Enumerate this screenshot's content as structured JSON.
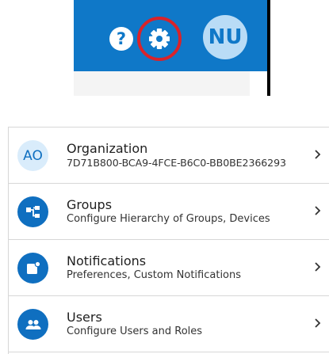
{
  "header": {
    "help_glyph": "?",
    "user_initials": "NU",
    "accent": "#0f78c8",
    "highlight_ring": "#d9232a",
    "icons": [
      "help-icon",
      "gear-icon"
    ]
  },
  "menu": {
    "items": [
      {
        "id": "organization",
        "initials": "AO",
        "title": "Organization",
        "subtitle": "7D71B800-BCA9-4FCE-B6C0-BB0BE2366293"
      },
      {
        "id": "groups",
        "icon": "hierarchy-icon",
        "title": "Groups",
        "subtitle": "Configure Hierarchy of Groups, Devices"
      },
      {
        "id": "notifications",
        "icon": "notification-icon",
        "title": "Notifications",
        "subtitle": "Preferences, Custom Notifications"
      },
      {
        "id": "users",
        "icon": "users-icon",
        "title": "Users",
        "subtitle": "Configure Users and Roles"
      }
    ],
    "chevron_icon": "chevron-right-icon"
  }
}
